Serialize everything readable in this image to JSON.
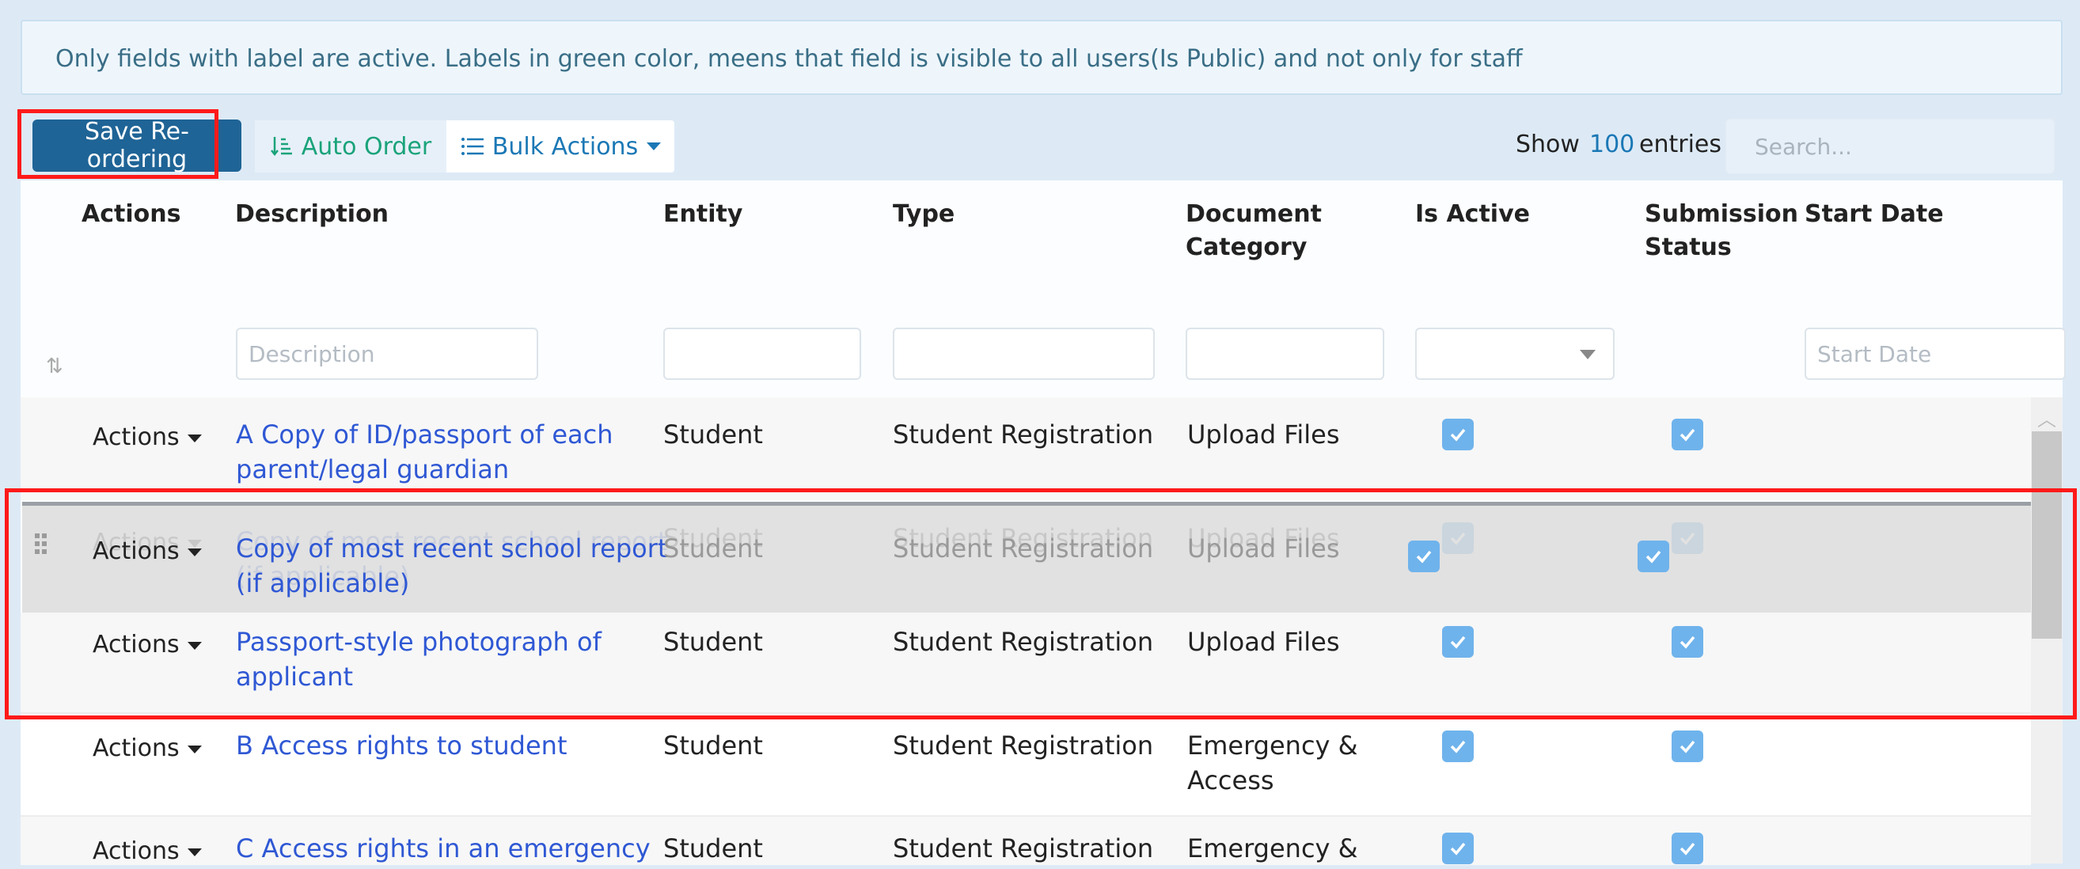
{
  "notice": "Only fields with label are active. Labels in green color, meens that field is visible to all users(Is Public) and not only for staff",
  "toolbar": {
    "save_label": "Save Re-ordering",
    "auto_order_label": "Auto Order",
    "bulk_actions_label": "Bulk Actions",
    "show_label": "Show",
    "show_count": "100",
    "entries_label": "entries",
    "search_placeholder": "Search..."
  },
  "columns": {
    "actions": "Actions",
    "description": "Description",
    "entity": "Entity",
    "type": "Type",
    "document_category_1": "Document",
    "document_category_2": "Category",
    "is_active": "Is Active",
    "submission_status_1": "Submission",
    "submission_status_2": "Status",
    "start_date": "Start Date"
  },
  "filters": {
    "description_placeholder": "Description",
    "start_date_placeholder": "Start Date"
  },
  "rows": [
    {
      "actions": "Actions",
      "description_1": "A Copy of ID/passport of each",
      "description_2": "parent/legal guardian",
      "entity": "Student",
      "type": "Student Registration",
      "category_1": "Upload Files",
      "category_2": "",
      "is_active": true,
      "submission_status": true
    },
    {
      "actions": "Actions",
      "description_1": "Copy of most recent school report",
      "description_2": "(if applicable)",
      "entity": "Student",
      "type": "Student Registration",
      "category_1": "Upload Files",
      "category_2": "",
      "is_active": true,
      "submission_status": true
    },
    {
      "actions": "Actions",
      "description_1": "Passport-style photograph of",
      "description_2": "applicant",
      "entity": "Student",
      "type": "Student Registration",
      "category_1": "Upload Files",
      "category_2": "",
      "is_active": true,
      "submission_status": true
    },
    {
      "actions": "Actions",
      "description_1": "B Access rights to student",
      "description_2": "",
      "entity": "Student",
      "type": "Student Registration",
      "category_1": "Emergency &",
      "category_2": "Access",
      "is_active": true,
      "submission_status": true
    },
    {
      "actions": "Actions",
      "description_1": "C Access rights in an emergency",
      "description_2": "",
      "entity": "Student",
      "type": "Student Registration",
      "category_1": "Emergency &",
      "category_2": "",
      "is_active": true,
      "submission_status": true
    }
  ],
  "colors": {
    "primary": "#1f6496",
    "link": "#2f58d4",
    "success": "#1aa37a",
    "checkbox": "#6fb3ec",
    "highlight": "#ff1a1a"
  }
}
